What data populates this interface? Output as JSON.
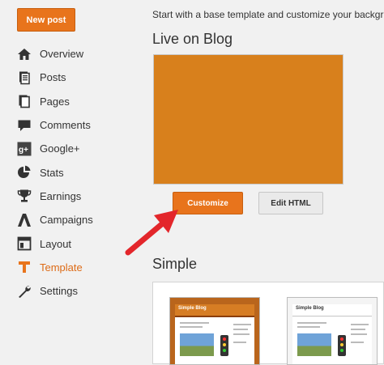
{
  "sidebar": {
    "new_post_label": "New post",
    "items": [
      {
        "label": "Overview",
        "icon": "home-icon"
      },
      {
        "label": "Posts",
        "icon": "posts-icon"
      },
      {
        "label": "Pages",
        "icon": "pages-icon"
      },
      {
        "label": "Comments",
        "icon": "comment-icon"
      },
      {
        "label": "Google+",
        "icon": "google-plus-icon"
      },
      {
        "label": "Stats",
        "icon": "pie-chart-icon"
      },
      {
        "label": "Earnings",
        "icon": "trophy-icon"
      },
      {
        "label": "Campaigns",
        "icon": "campaigns-icon"
      },
      {
        "label": "Layout",
        "icon": "layout-icon"
      },
      {
        "label": "Template",
        "icon": "template-icon",
        "active": true
      },
      {
        "label": "Settings",
        "icon": "wrench-icon"
      }
    ],
    "active_color": "#dd6b17"
  },
  "main": {
    "intro_text": "Start with a base template and customize your background",
    "live_title": "Live on Blog",
    "customize_label": "Customize",
    "edit_html_label": "Edit HTML",
    "simple_title": "Simple",
    "thumbnails": [
      {
        "blog_name": "Simple Blog"
      },
      {
        "blog_name": "Simple Blog"
      }
    ]
  },
  "colors": {
    "accent": "#e8741c",
    "preview": "#d8801c",
    "arrow": "#e3262b"
  }
}
